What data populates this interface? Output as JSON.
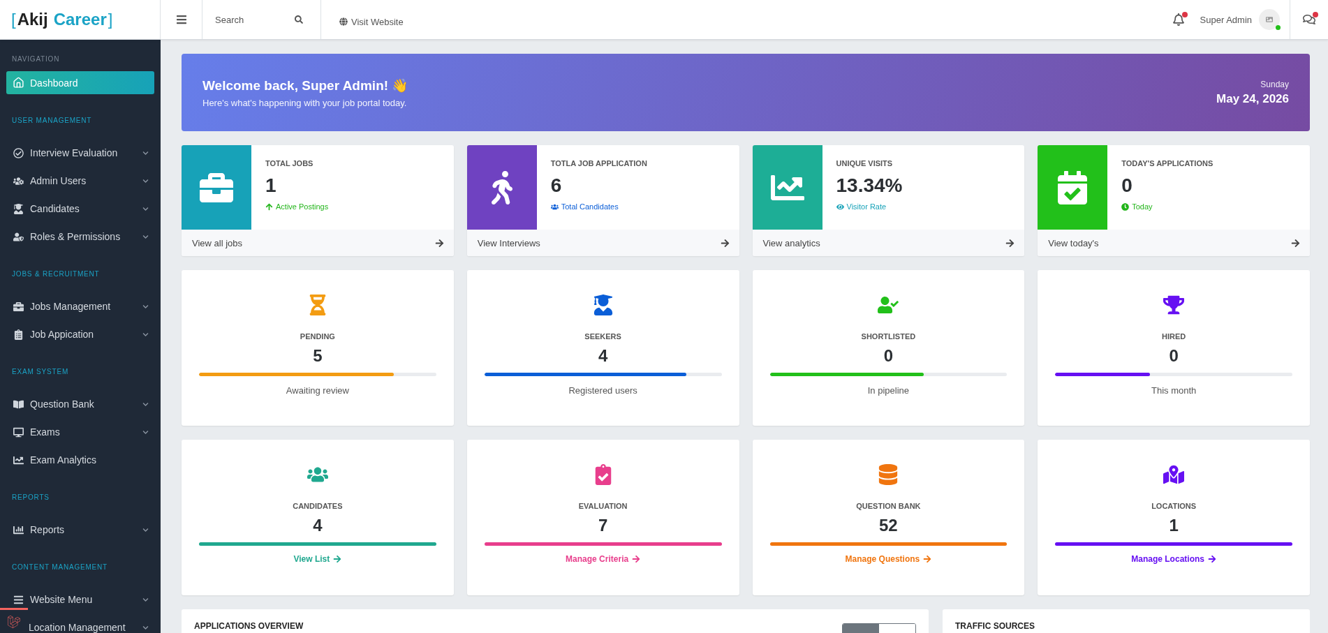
{
  "logo": {
    "open": "[",
    "first": "Akij",
    "second": "Career",
    "close": "]"
  },
  "header": {
    "search": {
      "placeholder": "Search"
    },
    "visit_link": "Visit Website",
    "notifications": {
      "unread": true
    },
    "user": {
      "name": "Super Admin",
      "online": true
    },
    "messages": {
      "unread": true
    }
  },
  "sidebar": {
    "sections": [
      {
        "title": "NAVIGATION",
        "color": "#7b8794",
        "items": [
          {
            "label": "Dashboard",
            "selected": true,
            "expandable": false
          }
        ]
      },
      {
        "title": "USER MANAGEMENT",
        "color": "#1ba3c6",
        "items": [
          {
            "label": "Interview Evaluation",
            "selected": false,
            "expandable": true
          },
          {
            "label": "Admin Users",
            "selected": false,
            "expandable": true
          },
          {
            "label": "Candidates",
            "selected": false,
            "expandable": true
          },
          {
            "label": "Roles & Permissions",
            "selected": false,
            "expandable": true
          }
        ]
      },
      {
        "title": "JOBS & RECRUITMENT",
        "color": "#1ba3c6",
        "items": [
          {
            "label": "Jobs Management",
            "selected": false,
            "expandable": true
          },
          {
            "label": "Job Appication",
            "selected": false,
            "expandable": true
          }
        ]
      },
      {
        "title": "EXAM SYSTEM",
        "color": "#1ba3c6",
        "items": [
          {
            "label": "Question Bank",
            "selected": false,
            "expandable": true
          },
          {
            "label": "Exams",
            "selected": false,
            "expandable": true
          },
          {
            "label": "Exam Analytics",
            "selected": false,
            "expandable": false
          }
        ]
      },
      {
        "title": "REPORTS",
        "color": "#1ba3c6",
        "items": [
          {
            "label": "Reports",
            "selected": false,
            "expandable": true
          }
        ]
      },
      {
        "title": "CONTENT MANAGEMENT",
        "color": "#1ba3c6",
        "items": [
          {
            "label": "Website Menu",
            "selected": false,
            "expandable": true
          },
          {
            "label": "Location Management",
            "selected": false,
            "expandable": true
          }
        ]
      }
    ]
  },
  "welcome": {
    "title": "Welcome back, Super Admin! 👋",
    "subtitle": "Here's what's happening with your job portal today.",
    "day": "Sunday",
    "date": "May 24, 2026"
  },
  "stat_cards": [
    {
      "label": "TOTAL JOBS",
      "value": "1",
      "color": "#17a2b8",
      "note": {
        "text": "Active Postings",
        "color": "#22b51a"
      },
      "link": "View all jobs"
    },
    {
      "label": "TOTLA JOB APPLICATION",
      "value": "6",
      "color": "#6f42c1",
      "note": {
        "text": "Total Candidates",
        "color": "#0b5ed7"
      },
      "link": "View Interviews"
    },
    {
      "label": "UNIQUE VISITS",
      "value": "13.34%",
      "color": "#1dae96",
      "note": {
        "text": "Visitor Rate",
        "color": "#17a2b8"
      },
      "link": "View analytics"
    },
    {
      "label": "TODAY'S APPLICATIONS",
      "value": "0",
      "color": "#22c01a",
      "note": {
        "text": "Today",
        "color": "#22b51a"
      },
      "link": "View today's"
    }
  ],
  "metric_cards": [
    {
      "kind": "progress",
      "label": "PENDING",
      "value": "5",
      "color": "#f39c12",
      "level": 0.82,
      "caption": "Awaiting review"
    },
    {
      "kind": "progress",
      "label": "SEEKERS",
      "value": "4",
      "color": "#0b5ed7",
      "level": 0.85,
      "caption": "Registered users"
    },
    {
      "kind": "progress",
      "label": "SHORTLISTED",
      "value": "0",
      "color": "#22c01a",
      "level": 0.65,
      "caption": "In pipeline"
    },
    {
      "kind": "progress",
      "label": "HIRED",
      "value": "0",
      "color": "#6610f2",
      "level": 0.4,
      "caption": "This month"
    },
    {
      "kind": "link",
      "label": "CANDIDATES",
      "value": "4",
      "color": "#20a88f",
      "caption": "View List"
    },
    {
      "kind": "link",
      "label": "EVALUATION",
      "value": "7",
      "color": "#e83e8c",
      "caption": "Manage Criteria"
    },
    {
      "kind": "link",
      "label": "QUESTION BANK",
      "value": "52",
      "color": "#f0750f",
      "caption": "Manage Questions"
    },
    {
      "kind": "link",
      "label": "LOCATIONS",
      "value": "1",
      "color": "#6610f2",
      "caption": "Manage Locations"
    }
  ],
  "panels": [
    {
      "title": "APPLICATIONS OVERVIEW",
      "toggle": true
    },
    {
      "title": "TRAFFIC SOURCES",
      "toggle": false
    }
  ]
}
